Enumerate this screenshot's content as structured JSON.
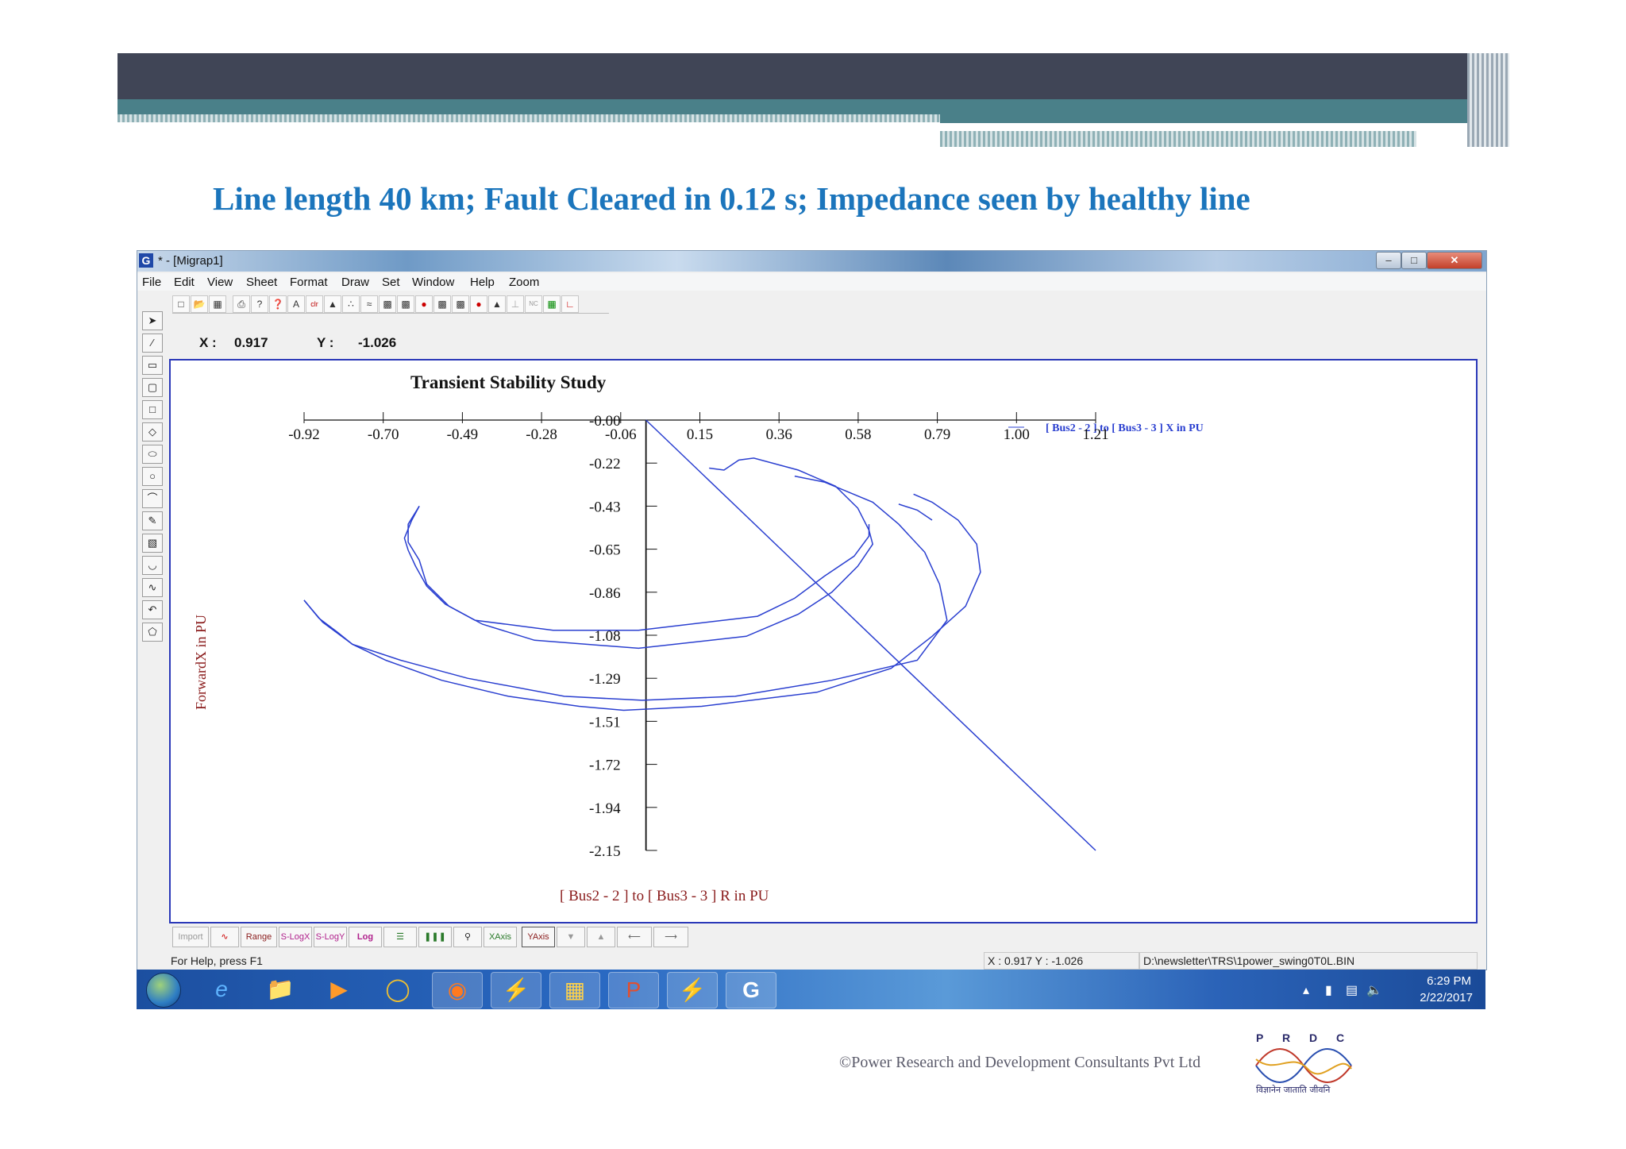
{
  "slide": {
    "title": "Line length 40 km; Fault Cleared in 0.12 s; Impedance seen by healthy line",
    "footer": "©Power Research and Development Consultants Pvt Ltd",
    "logo": {
      "letters": "P R D C",
      "tagline": "विज्ञानेन जाताति जीवनि"
    }
  },
  "window": {
    "title": "* - [Migrap1]",
    "menu": [
      "File",
      "Edit",
      "View",
      "Sheet",
      "Format",
      "Draw",
      "Set",
      "Window",
      "Help",
      "Zoom"
    ],
    "coord": {
      "x_label": "X :",
      "x_value": "0.917",
      "y_label": "Y :",
      "y_value": "-1.026"
    },
    "bottom_buttons": [
      "Import",
      "Range",
      "S-LogX",
      "S-LogY",
      "Log",
      "XAxis",
      "YAxis"
    ],
    "status": {
      "help": "For Help, press F1",
      "coord": "X : 0.917  Y : -1.026",
      "file": "D:\\newsletter\\TRS\\1power_swing0T0L.BIN"
    }
  },
  "taskbar": {
    "time": "6:29 PM",
    "date": "2/22/2017"
  },
  "chart_data": {
    "type": "line",
    "title": "Transient Stability Study",
    "xlabel": "[ Bus2    -    2 ] to [ Bus3    -    3 ]  R in PU",
    "ylabel": "ForwardX in PU",
    "legend": "[ Bus2   -   2 ] to [ Bus3   -   3 ]  X in PU",
    "x_ticks": [
      "-0.92",
      "-0.70",
      "-0.49",
      "-0.28",
      "-0.06",
      "0.15",
      "0.36",
      "0.58",
      "0.79",
      "1.00",
      "1.21"
    ],
    "y_ticks": [
      "-0.00",
      "-0.22",
      "-0.43",
      "-0.65",
      "-0.86",
      "-1.08",
      "-1.29",
      "-1.51",
      "-1.72",
      "-1.94",
      "-2.15"
    ],
    "xlim": [
      -0.92,
      1.21
    ],
    "ylim": [
      -2.15,
      0.0
    ],
    "color": "#2a3fd0",
    "series": [
      {
        "values": [
          [
            0.0,
            0.0
          ],
          [
            1.21,
            -2.15
          ]
        ]
      },
      {
        "values": [
          [
            -0.61,
            -0.43
          ],
          [
            -0.63,
            -0.5
          ],
          [
            -0.65,
            -0.59
          ],
          [
            -0.64,
            -0.65
          ],
          [
            -0.62,
            -0.73
          ],
          [
            -0.59,
            -0.83
          ],
          [
            -0.54,
            -0.92
          ],
          [
            -0.44,
            -1.02
          ],
          [
            -0.3,
            -1.1
          ],
          [
            -0.02,
            -1.14
          ],
          [
            0.27,
            -1.08
          ],
          [
            0.41,
            -0.97
          ],
          [
            0.5,
            -0.86
          ],
          [
            0.57,
            -0.73
          ],
          [
            0.61,
            -0.62
          ],
          [
            0.6,
            -0.55
          ],
          [
            0.57,
            -0.44
          ],
          [
            0.51,
            -0.33
          ],
          [
            0.41,
            -0.25
          ],
          [
            0.29,
            -0.19
          ],
          [
            0.25,
            -0.2
          ],
          [
            0.21,
            -0.25
          ],
          [
            0.17,
            -0.24
          ]
        ]
      },
      {
        "values": [
          [
            -0.61,
            -0.43
          ],
          [
            -0.64,
            -0.52
          ],
          [
            -0.64,
            -0.61
          ],
          [
            -0.61,
            -0.7
          ],
          [
            -0.59,
            -0.82
          ],
          [
            -0.53,
            -0.93
          ],
          [
            -0.46,
            -1.0
          ],
          [
            -0.25,
            -1.05
          ],
          [
            -0.02,
            -1.05
          ],
          [
            0.3,
            -0.98
          ],
          [
            0.4,
            -0.89
          ],
          [
            0.48,
            -0.78
          ],
          [
            0.56,
            -0.68
          ],
          [
            0.6,
            -0.58
          ],
          [
            0.6,
            -0.52
          ]
        ]
      },
      {
        "values": [
          [
            -0.92,
            -0.9
          ],
          [
            -0.88,
            -0.99
          ],
          [
            -0.83,
            -1.06
          ],
          [
            -0.79,
            -1.12
          ],
          [
            -0.7,
            -1.2
          ],
          [
            -0.55,
            -1.3
          ],
          [
            -0.37,
            -1.38
          ],
          [
            -0.18,
            -1.43
          ],
          [
            -0.06,
            -1.45
          ],
          [
            0.15,
            -1.43
          ],
          [
            0.46,
            -1.36
          ],
          [
            0.66,
            -1.24
          ],
          [
            0.77,
            -1.08
          ],
          [
            0.86,
            -0.93
          ],
          [
            0.9,
            -0.76
          ],
          [
            0.89,
            -0.62
          ],
          [
            0.84,
            -0.5
          ],
          [
            0.77,
            -0.41
          ],
          [
            0.72,
            -0.37
          ]
        ]
      },
      {
        "values": [
          [
            -0.92,
            -0.9
          ],
          [
            -0.87,
            -1.01
          ],
          [
            -0.79,
            -1.12
          ],
          [
            -0.66,
            -1.2
          ],
          [
            -0.48,
            -1.29
          ],
          [
            -0.22,
            -1.38
          ],
          [
            -0.01,
            -1.4
          ],
          [
            0.24,
            -1.38
          ],
          [
            0.5,
            -1.3
          ],
          [
            0.73,
            -1.2
          ],
          [
            0.81,
            -1.0
          ],
          [
            0.79,
            -0.82
          ],
          [
            0.75,
            -0.66
          ],
          [
            0.68,
            -0.52
          ],
          [
            0.61,
            -0.41
          ],
          [
            0.48,
            -0.31
          ],
          [
            0.4,
            -0.28
          ]
        ]
      },
      {
        "values": [
          [
            0.68,
            -0.42
          ],
          [
            0.73,
            -0.45
          ],
          [
            0.77,
            -0.5
          ]
        ]
      }
    ]
  }
}
